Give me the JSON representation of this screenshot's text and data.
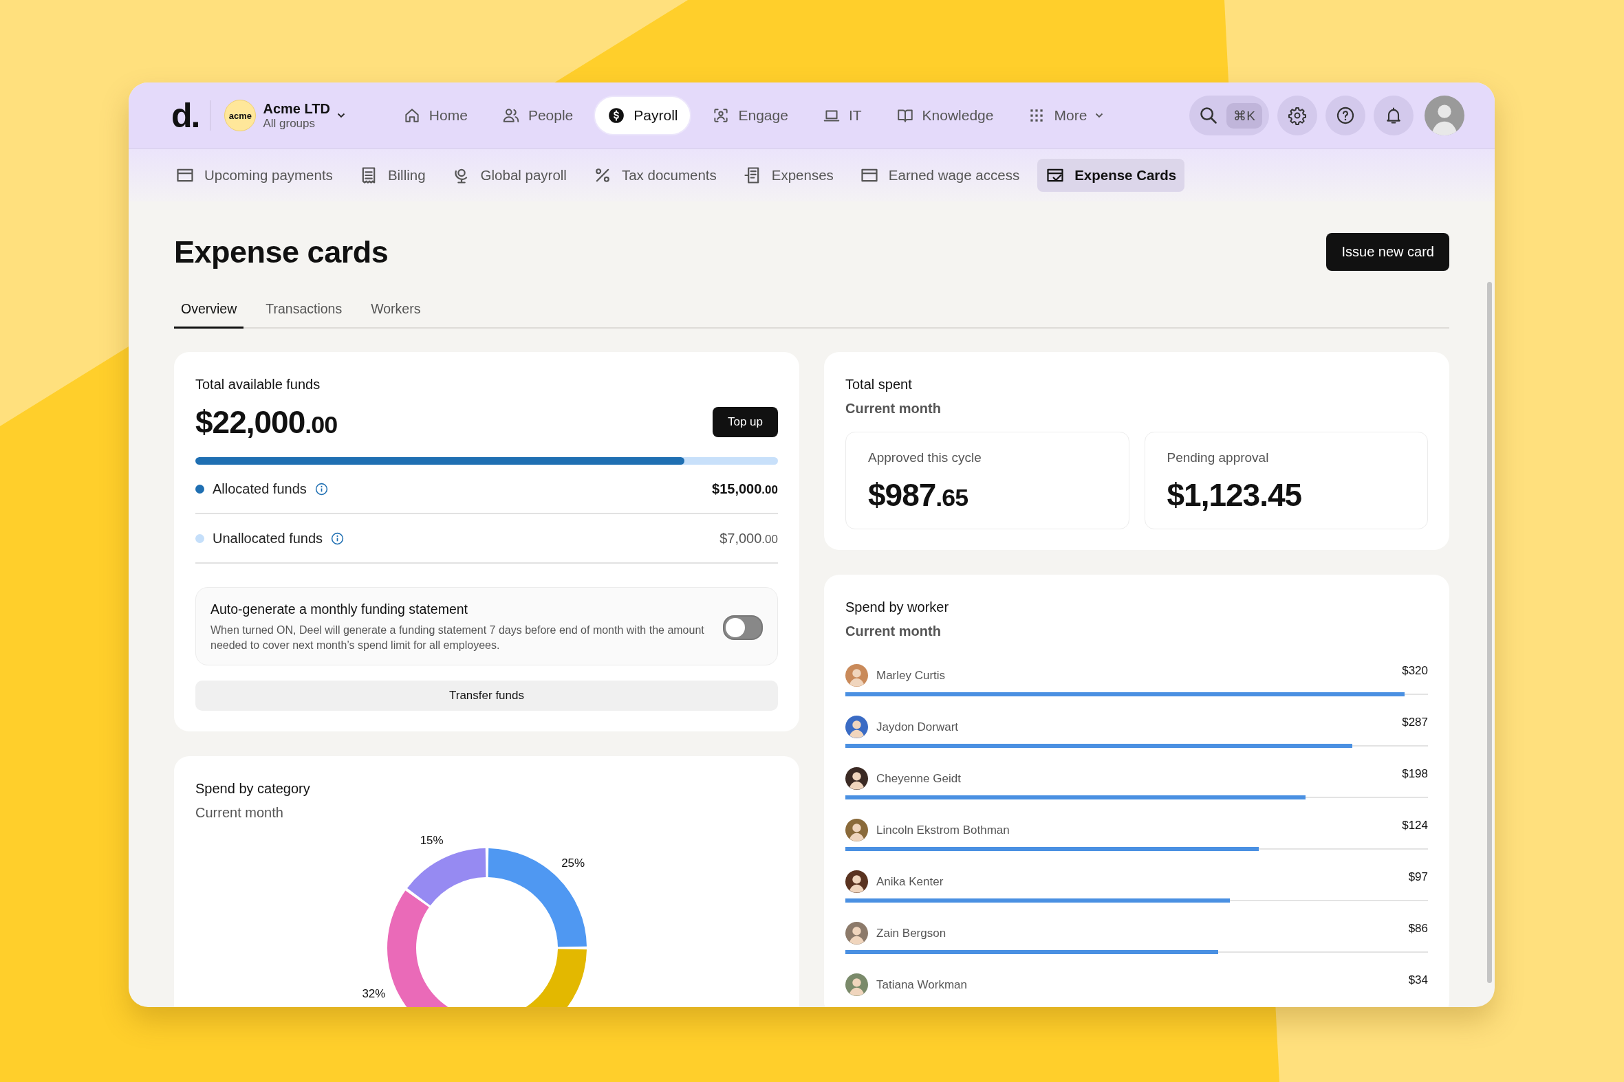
{
  "logo": "d.",
  "org": {
    "badge": "acme",
    "name": "Acme LTD",
    "subtitle": "All groups"
  },
  "nav": [
    {
      "label": "Home",
      "selected": false
    },
    {
      "label": "People",
      "selected": false
    },
    {
      "label": "Payroll",
      "selected": true
    },
    {
      "label": "Engage",
      "selected": false
    },
    {
      "label": "IT",
      "selected": false
    },
    {
      "label": "Knowledge",
      "selected": false
    },
    {
      "label": "More",
      "selected": false
    }
  ],
  "search": {
    "shortcut": "⌘K"
  },
  "subnav": [
    {
      "label": "Upcoming payments",
      "selected": false
    },
    {
      "label": "Billing",
      "selected": false
    },
    {
      "label": "Global payroll",
      "selected": false
    },
    {
      "label": "Tax documents",
      "selected": false
    },
    {
      "label": "Expenses",
      "selected": false
    },
    {
      "label": "Earned wage access",
      "selected": false
    },
    {
      "label": "Expense Cards",
      "selected": true
    }
  ],
  "page": {
    "title": "Expense cards",
    "action": "Issue new card"
  },
  "tabs": [
    {
      "label": "Overview",
      "selected": true
    },
    {
      "label": "Transactions",
      "selected": false
    },
    {
      "label": "Workers",
      "selected": false
    }
  ],
  "funds": {
    "title": "Total available funds",
    "amount": "$22,000",
    "cents": ".00",
    "top_up": "Top up",
    "level": 0.84,
    "rows": [
      {
        "label": "Allocated funds",
        "amount": "$15,000",
        "cents": ".00",
        "color": "#1f6fb2"
      },
      {
        "label": "Unallocated funds",
        "amount": "$7,000",
        "cents": ".00",
        "color": "#c5dffa"
      }
    ],
    "statement": {
      "title": "Auto-generate a monthly funding statement",
      "text": "When turned ON, Deel will generate a funding statement 7 days before end of month with the amount needed to cover next month’s spend limit for all employees.",
      "on": false
    },
    "transfer": "Transfer funds"
  },
  "total_spent": {
    "title": "Total spent",
    "subtitle": "Current month",
    "stats": [
      {
        "label": "Approved this cycle",
        "amount": "$987",
        "cents": ".65"
      },
      {
        "label": "Pending approval",
        "amount": "$1,123.45"
      }
    ]
  },
  "category": {
    "title": "Spend by category",
    "subtitle": "Current month",
    "chart_data": {
      "type": "donut",
      "values": [
        25,
        28,
        32,
        15
      ],
      "value_labels": [
        "25%",
        null,
        "32%",
        "15%"
      ]
    }
  },
  "workers": {
    "title": "Spend by worker",
    "subtitle": "Current month",
    "rows": [
      {
        "name": "Marley Curtis",
        "amount": "$320",
        "level": 0.96
      },
      {
        "name": "Jaydon Dorwart",
        "amount": "$287",
        "level": 0.87
      },
      {
        "name": "Cheyenne Geidt",
        "amount": "$198",
        "level": 0.79
      },
      {
        "name": "Lincoln Ekstrom Bothman",
        "amount": "$124",
        "level": 0.71
      },
      {
        "name": "Anika Kenter",
        "amount": "$97",
        "level": 0.66
      },
      {
        "name": "Zain Bergson",
        "amount": "$86",
        "level": 0.64
      },
      {
        "name": "Tatiana Workman",
        "amount": "$34"
      }
    ]
  }
}
